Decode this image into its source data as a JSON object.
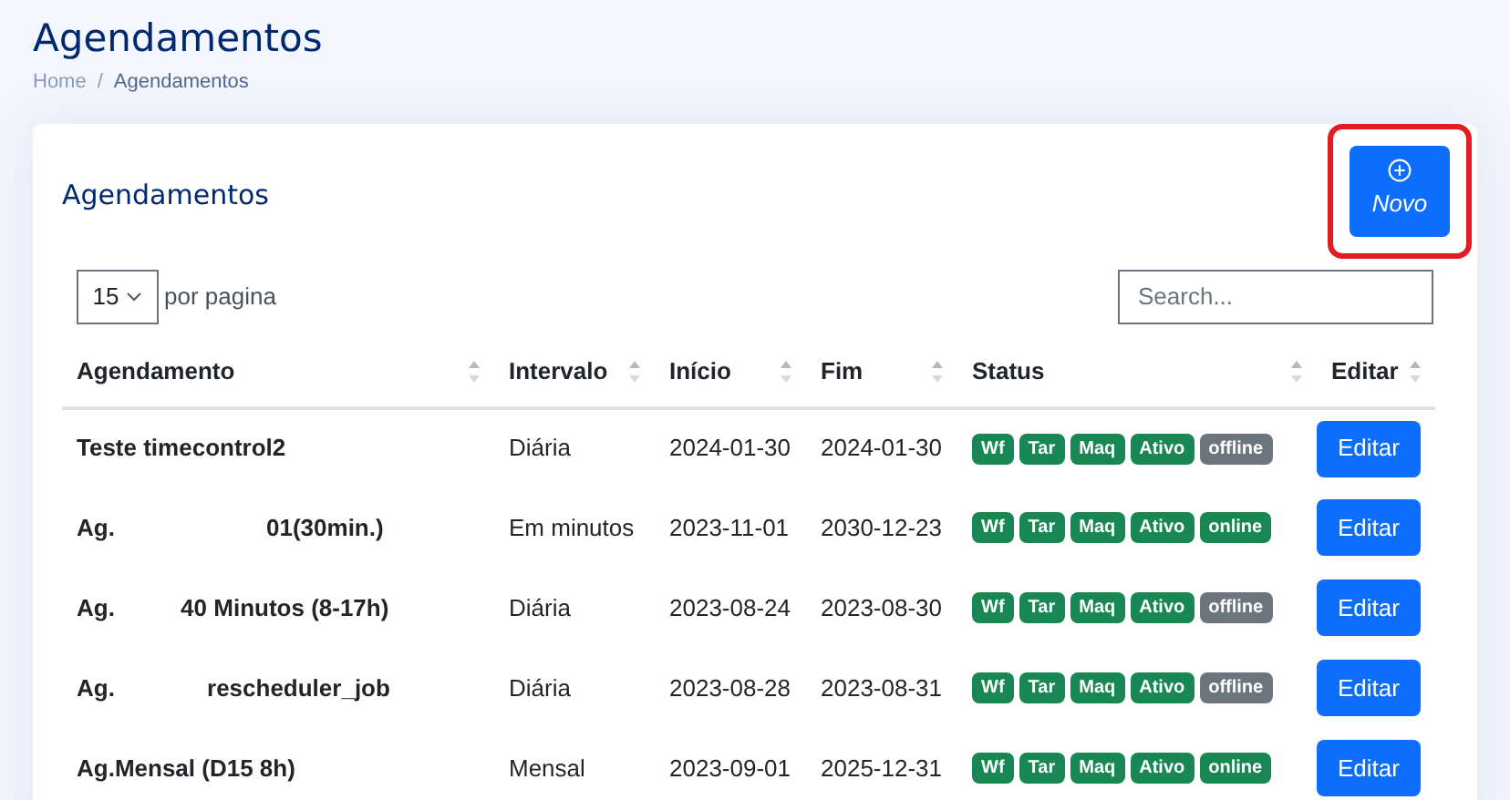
{
  "page_title": "Agendamentos",
  "breadcrumb_separator": "/",
  "breadcrumb": [
    {
      "label": "Home",
      "selected": false
    },
    {
      "label": "Agendamentos",
      "selected": true
    }
  ],
  "card": {
    "title": "Agendamentos",
    "new_button": {
      "label": "Novo",
      "highlighted": true
    },
    "page_size": {
      "value": "15",
      "label": "por pagina"
    },
    "search": {
      "placeholder": "Search..."
    },
    "table": {
      "columns": [
        {
          "label": "Agendamento",
          "sortable": true
        },
        {
          "label": "Intervalo",
          "sortable": true
        },
        {
          "label": "Início",
          "sortable": true
        },
        {
          "label": "Fim",
          "sortable": true
        },
        {
          "label": "Status",
          "sortable": true
        },
        {
          "label": "Editar",
          "sortable": true
        }
      ],
      "rows": [
        {
          "name": "Teste timecontrol2",
          "interval": "Diária",
          "start": "2024-01-30",
          "end": "2024-01-30",
          "badges": [
            {
              "label": "Wf",
              "color": "#198754"
            },
            {
              "label": "Tar",
              "color": "#198754"
            },
            {
              "label": "Maq",
              "color": "#198754"
            },
            {
              "label": "Ativo",
              "color": "#198754"
            },
            {
              "label": "offline",
              "color": "#6c757d"
            }
          ],
          "action": "Editar"
        },
        {
          "name": "Ag.                       01(30min.)",
          "interval": "Em minutos",
          "start": "2023-11-01",
          "end": "2030-12-23",
          "badges": [
            {
              "label": "Wf",
              "color": "#198754"
            },
            {
              "label": "Tar",
              "color": "#198754"
            },
            {
              "label": "Maq",
              "color": "#198754"
            },
            {
              "label": "Ativo",
              "color": "#198754"
            },
            {
              "label": "online",
              "color": "#198754"
            }
          ],
          "action": "Editar"
        },
        {
          "name": "Ag.          40 Minutos (8-17h)",
          "interval": "Diária",
          "start": "2023-08-24",
          "end": "2023-08-30",
          "badges": [
            {
              "label": "Wf",
              "color": "#198754"
            },
            {
              "label": "Tar",
              "color": "#198754"
            },
            {
              "label": "Maq",
              "color": "#198754"
            },
            {
              "label": "Ativo",
              "color": "#198754"
            },
            {
              "label": "offline",
              "color": "#6c757d"
            }
          ],
          "action": "Editar"
        },
        {
          "name": "Ag.              rescheduler_job",
          "interval": "Diária",
          "start": "2023-08-28",
          "end": "2023-08-31",
          "badges": [
            {
              "label": "Wf",
              "color": "#198754"
            },
            {
              "label": "Tar",
              "color": "#198754"
            },
            {
              "label": "Maq",
              "color": "#198754"
            },
            {
              "label": "Ativo",
              "color": "#198754"
            },
            {
              "label": "offline",
              "color": "#6c757d"
            }
          ],
          "action": "Editar"
        },
        {
          "name": "Ag.Mensal (D15 8h)",
          "interval": "Mensal",
          "start": "2023-09-01",
          "end": "2025-12-31",
          "badges": [
            {
              "label": "Wf",
              "color": "#198754"
            },
            {
              "label": "Tar",
              "color": "#198754"
            },
            {
              "label": "Maq",
              "color": "#198754"
            },
            {
              "label": "Ativo",
              "color": "#198754"
            },
            {
              "label": "online",
              "color": "#198754"
            }
          ],
          "action": "Editar"
        }
      ]
    }
  }
}
